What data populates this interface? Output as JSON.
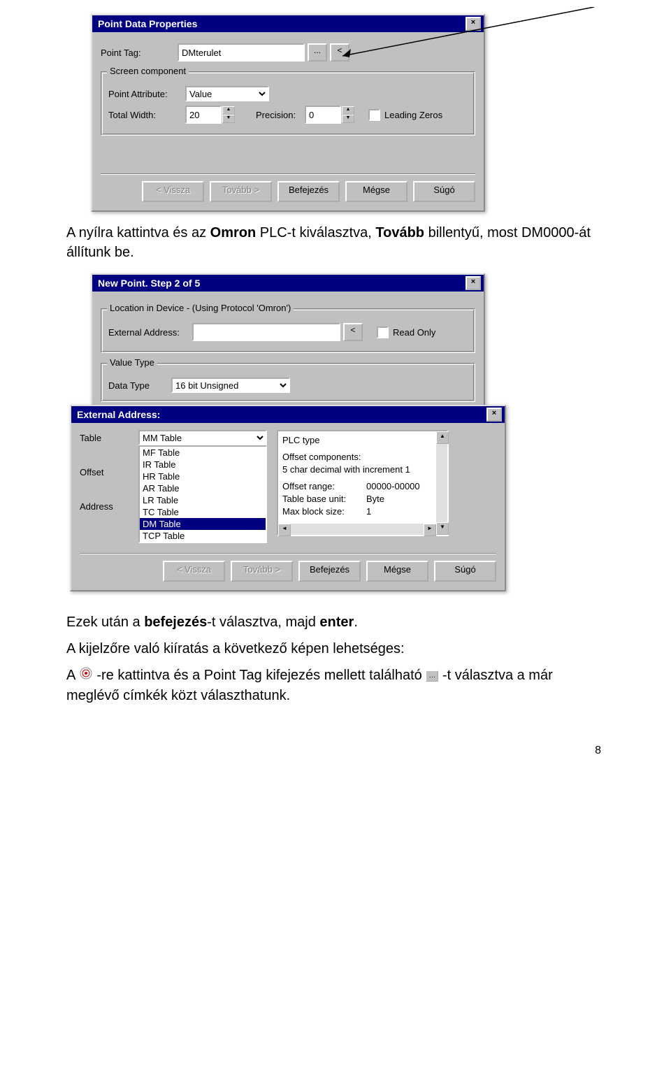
{
  "dialog1": {
    "title": "Point Data Properties",
    "close": "×",
    "pointTagLabel": "Point Tag:",
    "pointTagValue": "DMterulet",
    "ellipsis": "...",
    "lt": "<",
    "group1Title": "Screen component",
    "pointAttrLabel": "Point Attribute:",
    "pointAttrValue": "Value",
    "totalWidthLabel": "Total Width:",
    "totalWidthValue": "20",
    "precisionLabel": "Precision:",
    "precisionValue": "0",
    "leadingZeros": "Leading Zeros",
    "buttons": {
      "back": "< Vissza",
      "next": "Tovább >",
      "finish": "Befejezés",
      "cancel": "Mégse",
      "help": "Súgó"
    }
  },
  "para1": {
    "pre": "A nyílra kattintva és az ",
    "bold1": "Omron",
    "mid1": " PLC-t kiválasztva, ",
    "bold2": "Tovább",
    "post": " billentyű, most DM0000-át állítunk be."
  },
  "dialog2": {
    "title": "New Point.   Step 2 of 5",
    "close": "×",
    "group1Title": "Location in Device - (Using Protocol 'Omron')",
    "extAddrLabel": "External Address:",
    "extAddrValue": "",
    "lt": "<",
    "readOnly": "Read Only",
    "group2Title": "Value Type",
    "dataTypeLabel": "Data Type",
    "dataTypeValue": "16 bit Unsigned"
  },
  "dialog3": {
    "title": "External Address:",
    "close": "×",
    "tableLabel": "Table",
    "offsetLabel": "Offset",
    "addressLabel": "Address",
    "tableSelected": "MM Table",
    "listItems": [
      "MF Table",
      "IR Table",
      "HR Table",
      "AR Table",
      "LR Table",
      "TC Table",
      "DM Table",
      "TCP Table"
    ],
    "selectedIndex": 6,
    "info": {
      "line1": "PLC type",
      "line2": "Offset components:",
      "line3": "5 char decimal with increment 1",
      "line4a": "Offset range:",
      "line4b": "00000-00000",
      "line5a": "Table base unit:",
      "line5b": "Byte",
      "line6a": "Max block size:",
      "line6b": "1"
    },
    "buttons": {
      "back": "< Vissza",
      "next": "Tovább >",
      "finish": "Befejezés",
      "cancel": "Mégse",
      "help": "Súgó"
    }
  },
  "para2": {
    "pre": "Ezek után a ",
    "bold": "befejezés",
    "mid": "-t választva, majd ",
    "bold2": "enter",
    "post": "."
  },
  "para3": "A kijelzőre való kiíratás a következő képen lehetséges:",
  "para4": {
    "pre": "A ",
    "mid": " -re kattintva és a Point Tag kifejezés mellett található ",
    "post": " -t választva a már meglévő címkék közt választhatunk."
  },
  "pageNum": "8"
}
